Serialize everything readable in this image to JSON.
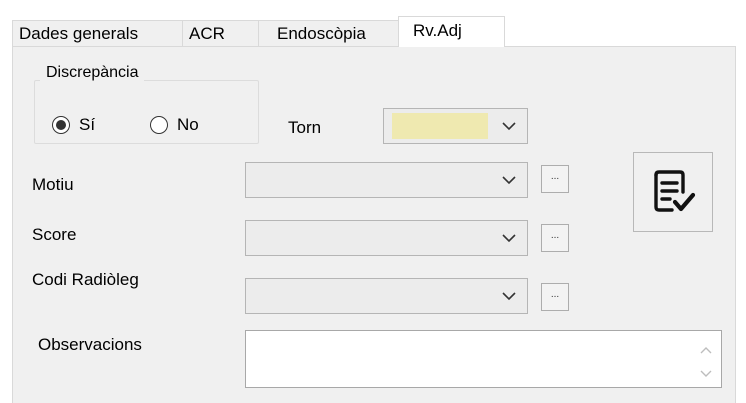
{
  "tabs": [
    {
      "label": "Dades generals"
    },
    {
      "label": "ACR"
    },
    {
      "label": "Endoscòpia"
    },
    {
      "label": "Rv.Adj",
      "active": true
    }
  ],
  "discrepancia": {
    "title": "Discrepància",
    "options": [
      {
        "label": "Sí",
        "selected": true
      },
      {
        "label": "No",
        "selected": false
      }
    ]
  },
  "torn": {
    "label": "Torn",
    "value": "",
    "fill_color": "#efe9b0"
  },
  "motiu": {
    "label": "Motiu",
    "value": "",
    "button_label": "..."
  },
  "score": {
    "label": "Score",
    "value": "",
    "button_label": "..."
  },
  "codi_radioleg": {
    "label": "Codi Radiòleg",
    "value": "",
    "button_label": "..."
  },
  "observacions": {
    "label": "Observacions",
    "value": ""
  },
  "review_button": {
    "icon": "checklist-check-icon"
  }
}
